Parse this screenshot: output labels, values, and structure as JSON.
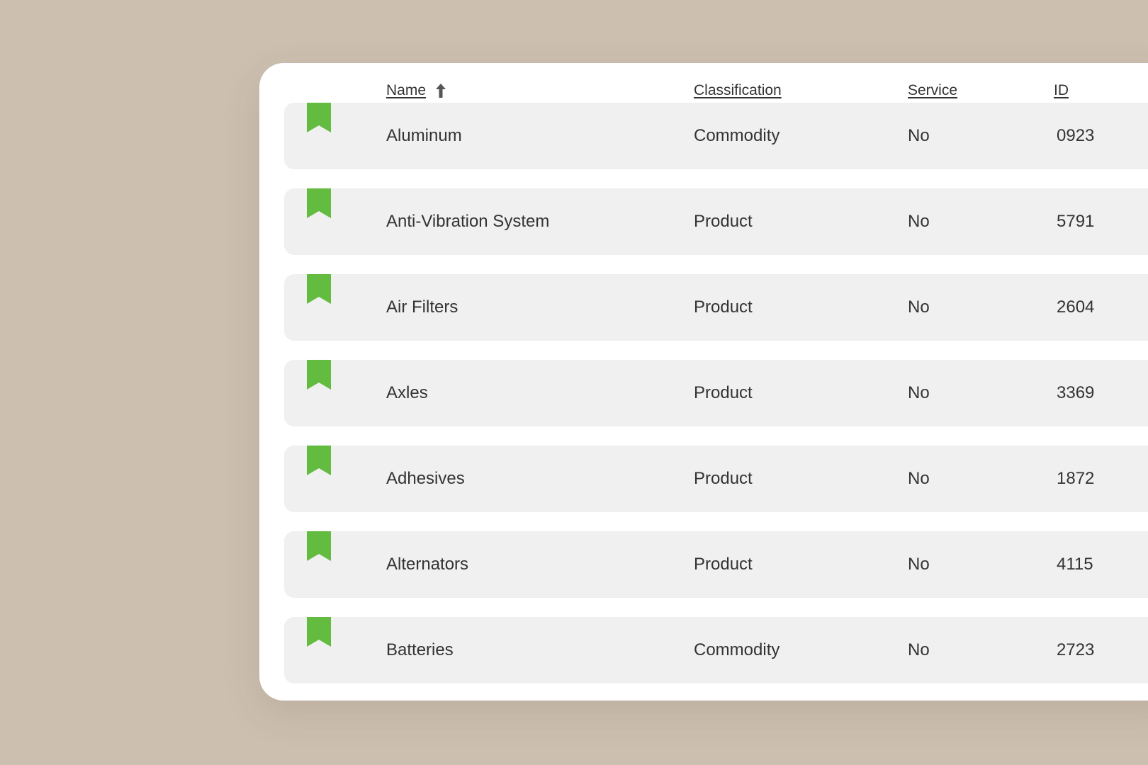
{
  "colors": {
    "background": "#ccbfb0",
    "card": "#ffffff",
    "row": "#f0f0f0",
    "bookmark": "#63bb40"
  },
  "table": {
    "headers": {
      "name": "Name",
      "classification": "Classification",
      "service": "Service",
      "id": "ID"
    },
    "sort": {
      "column": "name",
      "direction": "ascending",
      "icon": "arrow-up-icon"
    },
    "rows": [
      {
        "bookmark_icon": "bookmark-icon",
        "name": "Aluminum",
        "classification": "Commodity",
        "service": "No",
        "id": "0923"
      },
      {
        "bookmark_icon": "bookmark-icon",
        "name": "Anti-Vibration System",
        "classification": "Product",
        "service": "No",
        "id": "5791"
      },
      {
        "bookmark_icon": "bookmark-icon",
        "name": "Air Filters",
        "classification": "Product",
        "service": "No",
        "id": "2604"
      },
      {
        "bookmark_icon": "bookmark-icon",
        "name": "Axles",
        "classification": "Product",
        "service": "No",
        "id": "3369"
      },
      {
        "bookmark_icon": "bookmark-icon",
        "name": "Adhesives",
        "classification": "Product",
        "service": "No",
        "id": "1872"
      },
      {
        "bookmark_icon": "bookmark-icon",
        "name": "Alternators",
        "classification": "Product",
        "service": "No",
        "id": "4115"
      },
      {
        "bookmark_icon": "bookmark-icon",
        "name": "Batteries",
        "classification": "Commodity",
        "service": "No",
        "id": "2723"
      }
    ]
  }
}
